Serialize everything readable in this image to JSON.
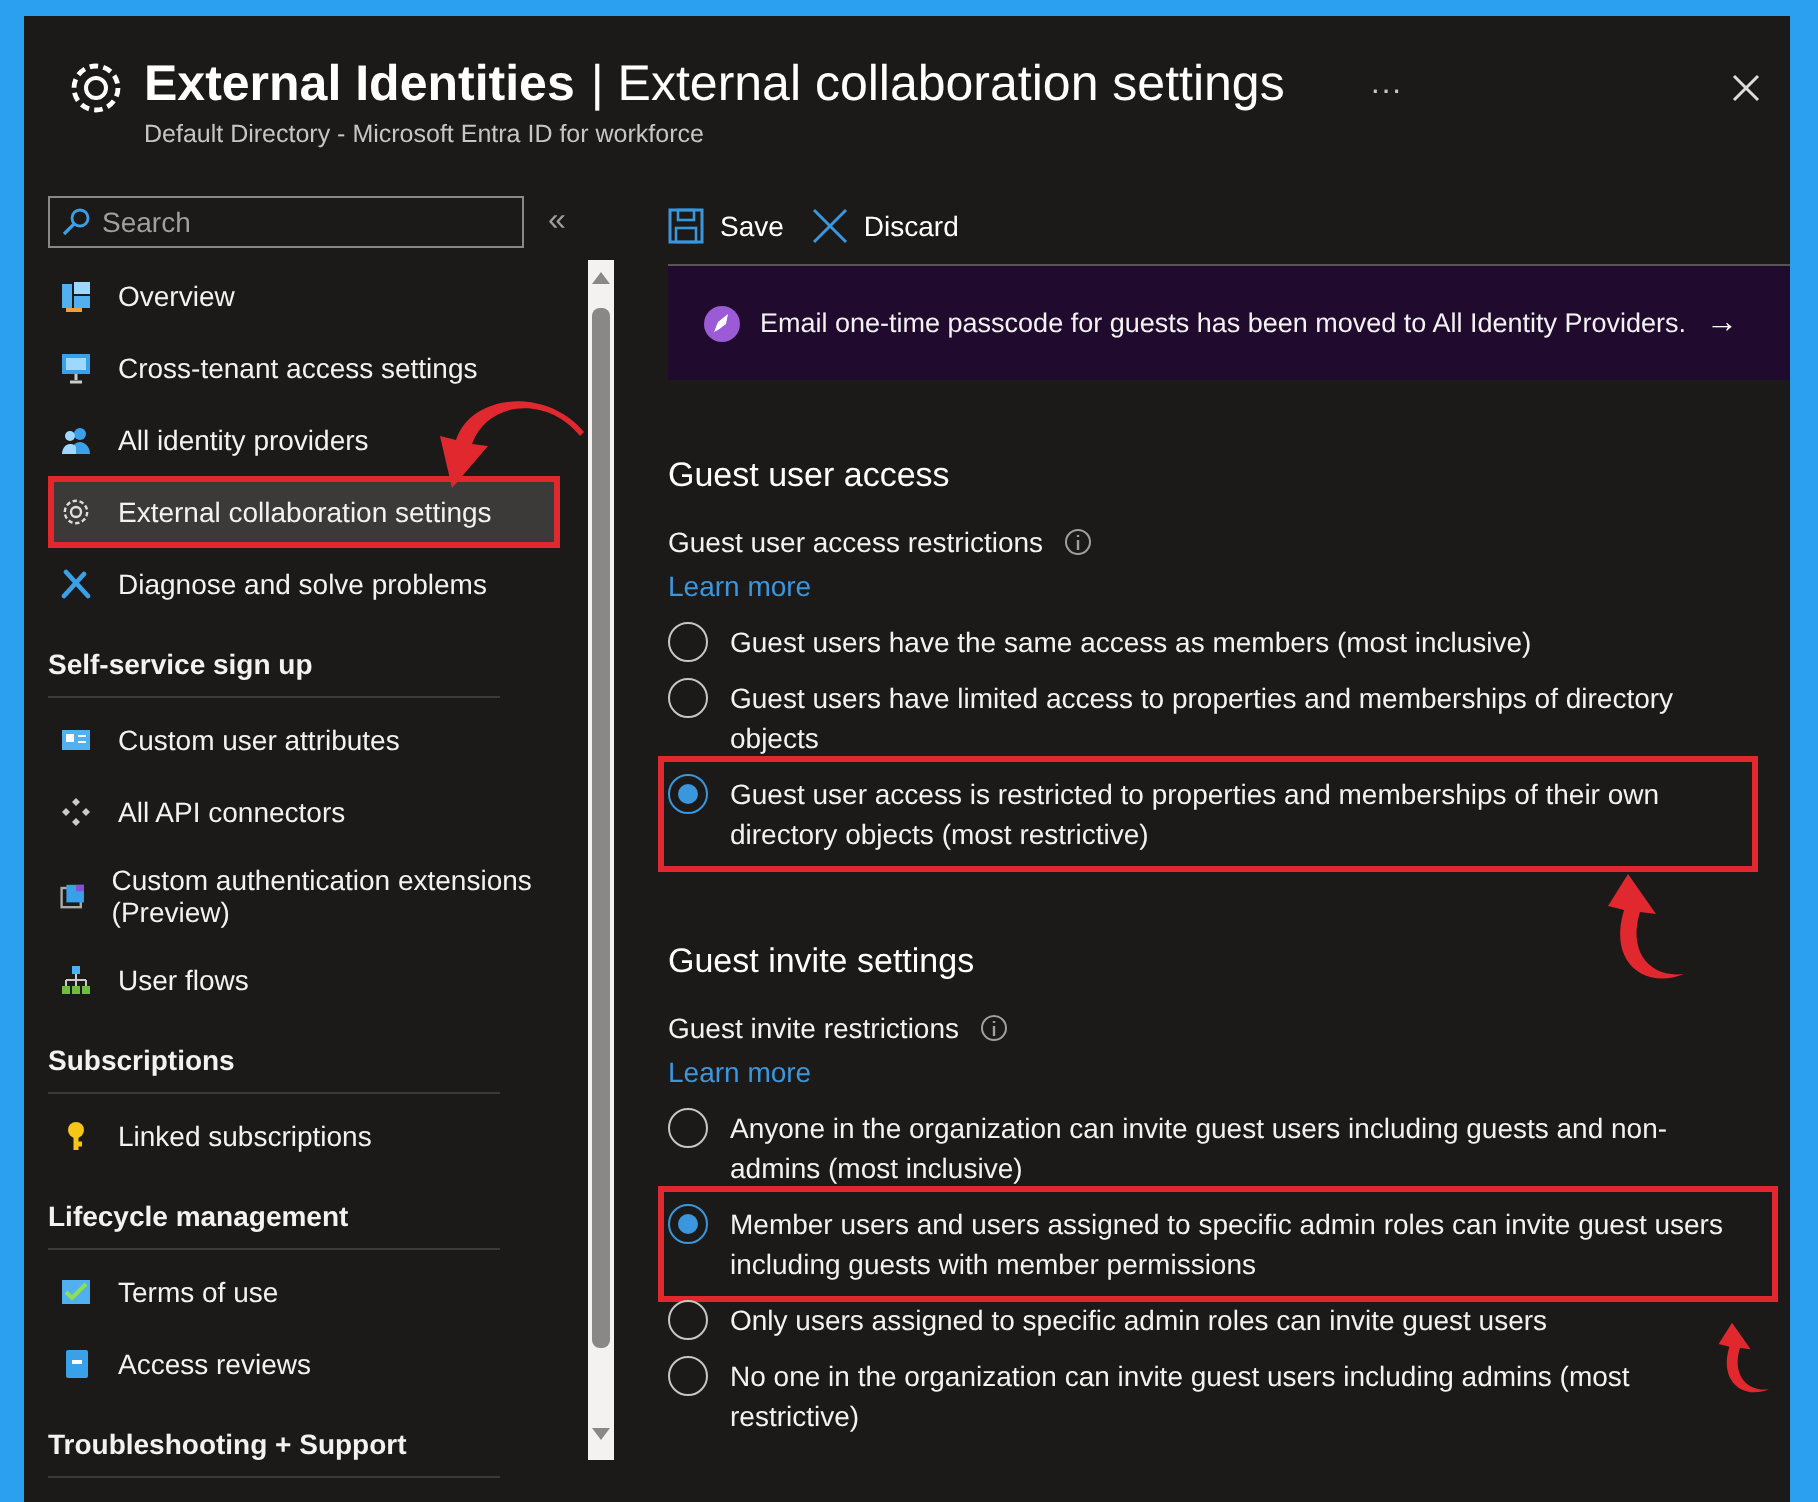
{
  "window": {
    "title_strong": "External Identities",
    "title_rest": "| External collaboration settings",
    "subtitle": "Default Directory - Microsoft Entra ID for workforce",
    "more": "···"
  },
  "sidebar": {
    "search": {
      "placeholder": "Search"
    },
    "collapse": "«",
    "sections": [
      {
        "items": [
          {
            "label": "Overview",
            "kind": "overview",
            "selected": false,
            "highlighted": false
          },
          {
            "label": "Cross-tenant access settings",
            "kind": "monitor",
            "selected": false,
            "highlighted": false
          },
          {
            "label": "All identity providers",
            "kind": "people",
            "selected": false,
            "highlighted": false
          },
          {
            "label": "External collaboration settings",
            "kind": "gear",
            "selected": true,
            "highlighted": true
          },
          {
            "label": "Diagnose and solve problems",
            "kind": "wrench",
            "selected": false,
            "highlighted": false
          }
        ]
      },
      {
        "heading": "Self-service sign up",
        "items": [
          {
            "label": "Custom user attributes",
            "kind": "card",
            "selected": false,
            "highlighted": false
          },
          {
            "label": "All API connectors",
            "kind": "connector",
            "selected": false,
            "highlighted": false
          },
          {
            "label": "Custom authentication extensions (Preview)",
            "kind": "extension",
            "selected": false,
            "highlighted": false
          },
          {
            "label": "User flows",
            "kind": "flow",
            "selected": false,
            "highlighted": false
          }
        ]
      },
      {
        "heading": "Subscriptions",
        "items": [
          {
            "label": "Linked subscriptions",
            "kind": "key",
            "selected": false,
            "highlighted": false
          }
        ]
      },
      {
        "heading": "Lifecycle management",
        "items": [
          {
            "label": "Terms of use",
            "kind": "check",
            "selected": false,
            "highlighted": false
          },
          {
            "label": "Access reviews",
            "kind": "book",
            "selected": false,
            "highlighted": false
          }
        ]
      },
      {
        "heading": "Troubleshooting + Support"
      }
    ]
  },
  "toolbar": [
    {
      "label": "Save",
      "kind": "save"
    },
    {
      "label": "Discard",
      "kind": "discard"
    }
  ],
  "banner": {
    "text": "Email one-time passcode for guests has been moved to All Identity Providers.",
    "arrow": "→"
  },
  "sections": [
    {
      "title": "Guest user access",
      "label": "Guest user access restrictions",
      "link": "Learn more",
      "options": [
        {
          "label": "Guest users have the same access as members (most inclusive)",
          "selected": false,
          "highlighted": false
        },
        {
          "label": "Guest users have limited access to properties and memberships of directory objects",
          "selected": false,
          "highlighted": false
        },
        {
          "label": "Guest user access is restricted to properties and memberships of their own directory objects (most restrictive)",
          "selected": true,
          "highlighted": true
        }
      ]
    },
    {
      "title": "Guest invite settings",
      "label": "Guest invite restrictions",
      "link": "Learn more",
      "options": [
        {
          "label": "Anyone in the organization can invite guest users including guests and non-admins (most inclusive)",
          "selected": false,
          "highlighted": false
        },
        {
          "label": "Member users and users assigned to specific admin roles can invite guest users including guests with member permissions",
          "selected": true,
          "highlighted": true
        },
        {
          "label": "Only users assigned to specific admin roles can invite guest users",
          "selected": false,
          "highlighted": false
        },
        {
          "label": "No one in the organization can invite guest users including admins (most restrictive)",
          "selected": false,
          "highlighted": false
        }
      ]
    }
  ]
}
